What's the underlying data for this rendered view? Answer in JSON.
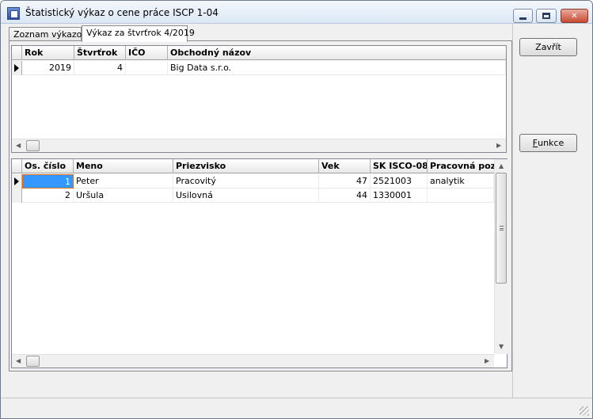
{
  "window": {
    "title": "Štatistický výkaz o cene práce ISCP 1-04"
  },
  "tabs": [
    {
      "label": "Zoznam výkazov"
    },
    {
      "label": "Výkaz za štvrťrok 4/2019"
    }
  ],
  "report_grid": {
    "columns": [
      "Rok",
      "Štvrťrok",
      "IČO",
      "Obchodný názov"
    ],
    "rows": [
      {
        "rok": "2019",
        "stvrtrok": "4",
        "ico": "",
        "nazov": "Big Data s.r.o."
      }
    ]
  },
  "employee_grid": {
    "columns": [
      "Os. číslo",
      "Meno",
      "Priezvisko",
      "Vek",
      "SK ISCO-08",
      "Pracovná pozí"
    ],
    "rows": [
      {
        "os_cislo": "1",
        "meno": "Peter",
        "priezvisko": "Pracovitý",
        "vek": "47",
        "isco": "2521003",
        "pozicia": "analytik"
      },
      {
        "os_cislo": "2",
        "meno": "Uršula",
        "priezvisko": "Usilovná",
        "vek": "44",
        "isco": "1330001",
        "pozicia": ""
      }
    ]
  },
  "buttons": {
    "close_label": "Zavřít",
    "func_label_underlined": "F",
    "func_label_rest": "unkce"
  }
}
